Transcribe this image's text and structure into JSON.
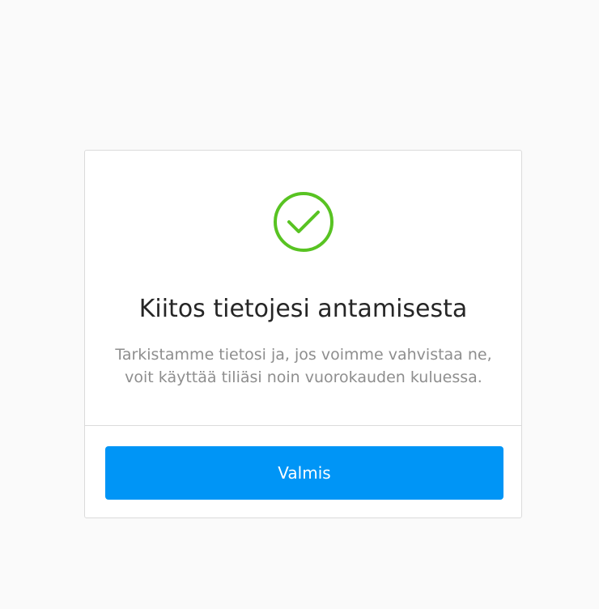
{
  "dialog": {
    "icon": "check-circle-icon",
    "icon_color": "#58c322",
    "title": "Kiitos tietojesi antamisesta",
    "message_line1": "Tarkistamme tietosi ja, jos voimme vahvistaa ne,",
    "message_line2": "voit käyttää tiliäsi noin vuorokauden kuluessa.",
    "button_label": "Valmis",
    "button_color": "#0095f6"
  }
}
